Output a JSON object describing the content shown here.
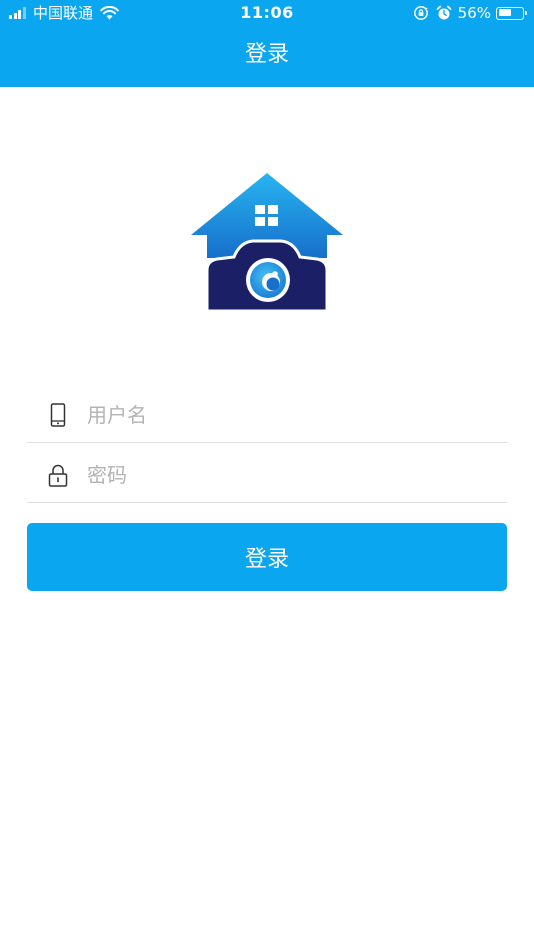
{
  "status_bar": {
    "carrier": "中国联通",
    "time": "11:06",
    "battery_percent": "56%",
    "battery_level": 0.56,
    "icons": [
      "signal-icon",
      "wifi-icon",
      "orientation-lock-icon",
      "alarm-icon",
      "battery-icon"
    ]
  },
  "nav": {
    "title": "登录"
  },
  "logo": {
    "icon": "house-camera-logo",
    "colors": {
      "roof": "#1e8fe0",
      "body": "#1b1f66",
      "lens": "#1e9ee8"
    }
  },
  "form": {
    "username": {
      "placeholder": "用户名",
      "value": "",
      "icon": "phone-icon"
    },
    "password": {
      "placeholder": "密码",
      "value": "",
      "icon": "lock-icon"
    },
    "submit_label": "登录"
  },
  "theme": {
    "accent": "#0aa6f0",
    "divider": "#dedede",
    "placeholder": "#b3b3b3"
  }
}
